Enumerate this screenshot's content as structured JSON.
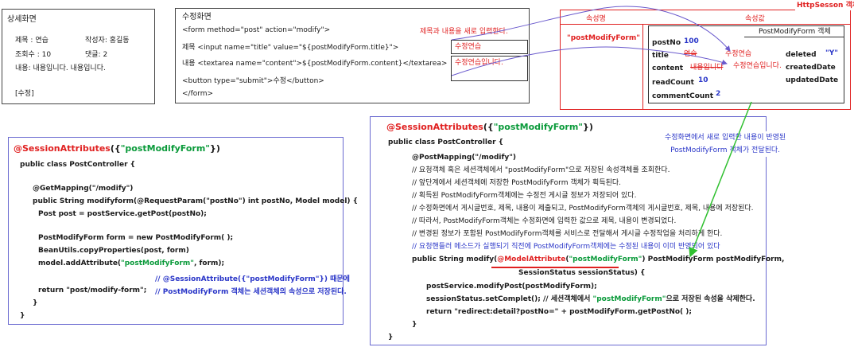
{
  "detail": {
    "title": "상세화면",
    "subject": "제목 : 연습",
    "writer": "작성자: 홍길동",
    "views": "조회수 : 10",
    "comments": "댓글: 2",
    "content": "내용: 내용입니다. 내용입니다.",
    "button": "[수정]"
  },
  "modify": {
    "title": "수정화면",
    "line1": "<form method=\"post\" action=\"modify\">",
    "line2": "제목 <input name=\"title\" value=\"${postModifyForm.title}\">",
    "line3": "내용 <textarea name=\"content\">${postModifyForm.content}</textarea>",
    "line4": "<button type=\"submit\">수정</button>",
    "line5": "</form>",
    "note": "제목과 내용을 새로 입력한다.",
    "title_input": "수정연습",
    "content_input": "수정연습입니다."
  },
  "session": {
    "label": "HttpSesson 객체",
    "col_name": "속성명",
    "col_value": "속성값",
    "attr_name": "\"postModifyForm\"",
    "obj_title": "PostModifyForm 객체",
    "fields": [
      {
        "k": "postNo",
        "v": "100"
      },
      {
        "k": "title",
        "old": "연습",
        "v": "수정연습"
      },
      {
        "k": "content",
        "old": "내용입니다",
        "v": "수정연습입니다."
      },
      {
        "k": "readCount",
        "v": "10"
      },
      {
        "k": "commentCount",
        "v": "2"
      }
    ],
    "right_fields": {
      "deleted_k": "deleted",
      "deleted_v": "\"Y\"",
      "created": "createdDate",
      "updated": "updatedDate"
    }
  },
  "left_code": {
    "annot_red": "@SessionAttributes",
    "annot_rest_open": "({",
    "annot_green": "\"postModifyForm\"",
    "annot_rest_close": "})",
    "lines": [
      "public class PostController {",
      "@GetMapping(\"/modify\")",
      "public String modifyform(@RequestParam(\"postNo\") int postNo, Model model) {",
      "Post post = postService.getPost(postNo);",
      "PostModifyForm form = new PostModifyForm( );",
      "BeanUtils.copyProperties(post, form)",
      "return \"post/modify-form\";",
      "}",
      "}"
    ],
    "model_pre": "model.addAttribute(",
    "model_green": "\"postModifyForm\"",
    "model_post": ", form);",
    "comment1": "// @SessionAttribute({\"postModifyForm\"}) 때문에",
    "comment2": "// PostModifyForm 객체는 세션객체의 속성으로 저장된다."
  },
  "right_code": {
    "annot_red": "@SessionAttributes",
    "annot_rest_open": "({",
    "annot_green": "\"postModifyForm\"",
    "annot_rest_close": "})",
    "class_line": "public class PostController {",
    "mapping": "@PostMapping(\"/modify\")",
    "comments": [
      "// 요청객체 혹은 세션객체에서 \"postModifyForm\"으로 저장된 속성객체를 조회한다.",
      "// 앞단계에서 세션객체에 저장한 PostModifyForm 객체가 획득된다.",
      "// 획득된 PostModifyForm객체에는 수정전 게시글 정보가 저장되어 있다.",
      "// 수정화면에서 게시글번호, 제목, 내용이 제출되고, PostModifyForm객체의 게시글번호, 제목, 내용에 저장된다.",
      "// 따라서, PostModifyForm객체는 수정화면에 입력한 값으로 제목, 내용이 변경되었다.",
      "// 변경된 정보가 포함된 PostModifyForm객체를 서비스로 전달해서 게시글 수정작업을 처리하게 한다."
    ],
    "comment_blue": "// 요청핸들러 메소드가 실행되기 직전에 PostModifyForm객체에는 수정된 내용이 이미 반영되어 있다",
    "sig_pre": "public String modify(",
    "sig_red": "@ModelAttribute",
    "sig_open": "(",
    "sig_green": "\"postModifyForm\"",
    "sig_close": ")",
    "sig_post": " PostModifyForm postModifyForm,",
    "sig_line2": "SessionStatus sessionStatus) {",
    "body1": "postService.modifyPost(postModifyForm);",
    "body2_pre": "sessionStatus.setComplet(); // 세션객체에서 ",
    "body2_green": "\"postModifyForm\"",
    "body2_post": "으로 저장된 속성을 삭제한다.",
    "body3": "return \"redirect:detail?postNo=\" + postModifyForm.getPostNo( );",
    "close1": "}",
    "close2": "}"
  },
  "callout": {
    "line1": "수정화면에서 새로 입력한 내용이 반영된",
    "line2": "PostModifyForm 객체가 전달된다."
  },
  "colors": {
    "accent_red": "#e02020",
    "accent_blue": "#2a36c8",
    "accent_green": "#0a9a3a",
    "arrow_green": "#30c030",
    "arrow_purple": "#6a5acd",
    "code_border": "#6a6ad0"
  }
}
